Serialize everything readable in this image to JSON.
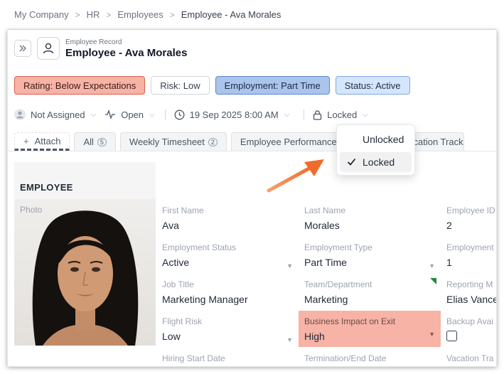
{
  "breadcrumb": [
    "My Company",
    "HR",
    "Employees",
    "Employee - Ava Morales"
  ],
  "header": {
    "subtitle": "Employee Record",
    "title": "Employee - Ava Morales"
  },
  "chips": [
    {
      "label": "Rating: Below Expectations",
      "style": "red"
    },
    {
      "label": "Risk: Low",
      "style": "white"
    },
    {
      "label": "Employment: Part Time",
      "style": "blue"
    },
    {
      "label": "Status: Active",
      "style": "lightblue"
    }
  ],
  "meta": {
    "assignee": "Not Assigned",
    "state": "Open",
    "datetime": "19 Sep 2025 8:00 AM",
    "lock": "Locked"
  },
  "tabs": [
    {
      "label": "Attach"
    },
    {
      "label": "All",
      "count": "5"
    },
    {
      "label": "Weekly Timesheet",
      "count": "2"
    },
    {
      "label": "Employee Performance R"
    },
    {
      "label": "oyee Vacation Track"
    }
  ],
  "dropdown": {
    "options": [
      "Unlocked",
      "Locked"
    ],
    "selected": "Locked"
  },
  "section": {
    "title": "EMPLOYEE",
    "photo_label": "Photo"
  },
  "fields": {
    "first_name": {
      "label": "First Name",
      "value": "Ava"
    },
    "last_name": {
      "label": "Last Name",
      "value": "Morales"
    },
    "employee_id": {
      "label": "Employee ID",
      "value": "2"
    },
    "employment_status": {
      "label": "Employment Status",
      "value": "Active"
    },
    "employment_type": {
      "label": "Employment Type",
      "value": "Part Time"
    },
    "employment_x": {
      "label": "Employment",
      "value": "1"
    },
    "job_title": {
      "label": "Job Title",
      "value": "Marketing Manager"
    },
    "team_department": {
      "label": "Team/Department",
      "value": "Marketing"
    },
    "reporting_manager": {
      "label": "Reporting M",
      "value": "Elias Vance"
    },
    "flight_risk": {
      "label": "Flight Risk",
      "value": "Low"
    },
    "business_impact": {
      "label": "Business Impact on Exit",
      "value": "High"
    },
    "backup_available": {
      "label": "Backup Avai"
    },
    "hiring_start_date": {
      "label": "Hiring Start Date"
    },
    "termination_end_date": {
      "label": "Termination/End Date"
    },
    "vacation_tracking": {
      "label": "Vacation Tra"
    }
  },
  "colors": {
    "arrow": "#f07a3c",
    "highlight": "#f6b3a6",
    "accent_green": "#1f8a3c"
  }
}
